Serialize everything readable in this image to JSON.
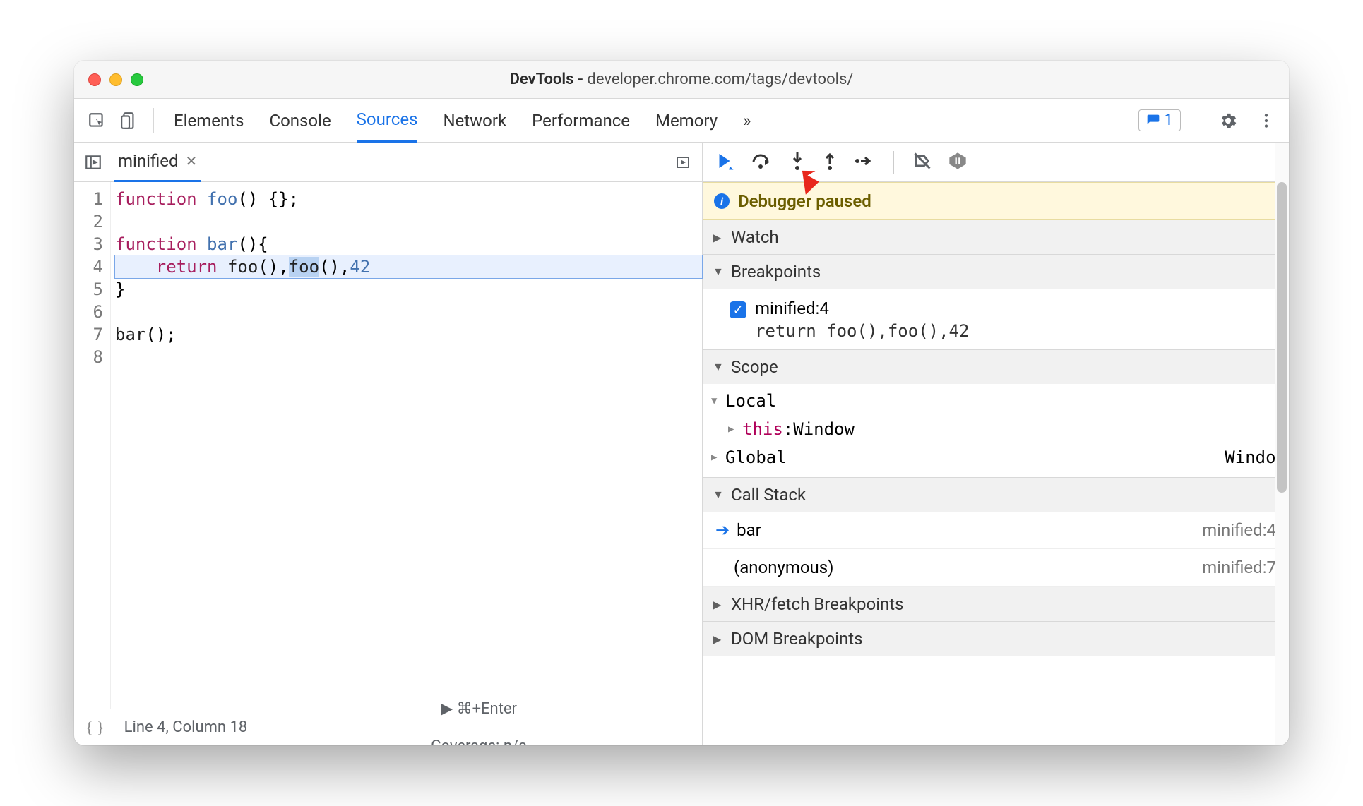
{
  "titlebar": {
    "app": "DevTools",
    "url": "developer.chrome.com/tags/devtools/"
  },
  "tabs": {
    "items": [
      "Elements",
      "Console",
      "Sources",
      "Network",
      "Performance",
      "Memory"
    ],
    "active": "Sources",
    "overflow": "»",
    "badge_count": "1"
  },
  "file": {
    "name": "minified"
  },
  "editor": {
    "gutter": [
      "1",
      "2",
      "3",
      "4",
      "5",
      "6",
      "7",
      "8"
    ],
    "status_line": "Line 4, Column 18",
    "run_hint": "⌘+Enter",
    "coverage": "Coverage: n/a"
  },
  "code": {
    "l1_kw": "function",
    "l1_name": "foo",
    "l1_rest": "() {};",
    "l3_kw": "function",
    "l3_name": "bar",
    "l3_rest": "(){",
    "l4_kw": "return",
    "l4_a": "foo",
    "l4_b": "foo",
    "l4_num": "42",
    "l5": "}",
    "l7_name": "bar",
    "l7_rest": "();"
  },
  "debugger": {
    "paused": "Debugger paused",
    "sections": {
      "watch": "Watch",
      "breakpoints": "Breakpoints",
      "scope": "Scope",
      "callstack": "Call Stack",
      "xhr": "XHR/fetch Breakpoints",
      "dom": "DOM Breakpoints"
    },
    "breakpoint": {
      "label": "minified:4",
      "code": "return foo(),foo(),42"
    },
    "scope": {
      "local": "Local",
      "this_label": "this",
      "this_value": "Window",
      "global": "Global",
      "global_value": "Window"
    },
    "callstack": [
      {
        "fn": "bar",
        "loc": "minified:4",
        "active": true
      },
      {
        "fn": "(anonymous)",
        "loc": "minified:7",
        "active": false
      }
    ]
  }
}
